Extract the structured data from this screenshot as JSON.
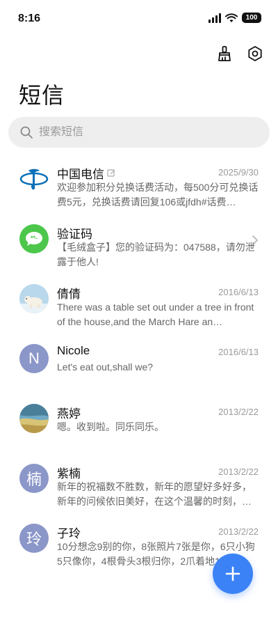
{
  "status_bar": {
    "time": "8:16",
    "battery": "100"
  },
  "header": {
    "title": "短信"
  },
  "search": {
    "placeholder": "搜索短信"
  },
  "conversations": [
    {
      "name": "中国电信",
      "date": "2025/9/30",
      "preview": "欢迎参加积分兑换话费活动，每500分可兑换话费5元，兑换话费请回复106或jfdh#话费…",
      "avatar_icon": "china-telecom-logo",
      "color": "#0a6fb8",
      "badge_icon": "edit-icon"
    },
    {
      "name": "验证码",
      "date": "",
      "preview": "【毛绒盒子】您的验证码为：047588，请勿泄露于他人!",
      "avatar_icon": "message-bubble-icon",
      "color": "#4cc74c"
    },
    {
      "name": "倩倩",
      "date": "2016/6/13",
      "preview": "There was a table set out under a tree in front of the house,and the March Hare an…",
      "avatar_icon": "polar-bear-photo",
      "color": "#a9cde6"
    },
    {
      "name": "Nicole",
      "date": "2016/6/13",
      "preview": "Let's eat out,shall we?",
      "avatar_letter": "N",
      "color": "#8b96c9"
    },
    {
      "name": "燕婷",
      "date": "2013/2/22",
      "preview": "嗯。收到啦。同乐同乐。",
      "avatar_icon": "landscape-photo",
      "color": "#5b9bb5"
    },
    {
      "name": "紫楠",
      "date": "2013/2/22",
      "preview": "新年的祝福数不胜数，新年的愿望好多好多，新年的问候依旧美好，在这个温馨的时刻，…",
      "avatar_letter": "楠",
      "color": "#8b96c9"
    },
    {
      "name": "子玲",
      "date": "2013/2/22",
      "preview": "10分想念9别的你，8张照片7张是你，6只小狗5只像你，4根骨头3根归你，2爪着地1完…",
      "avatar_letter": "玲",
      "color": "#8b96c9"
    }
  ],
  "icons": {
    "clean": "broom-icon",
    "settings": "settings-hex-icon",
    "fab": "plus-icon"
  },
  "colors": {
    "accent": "#3b82f6"
  }
}
